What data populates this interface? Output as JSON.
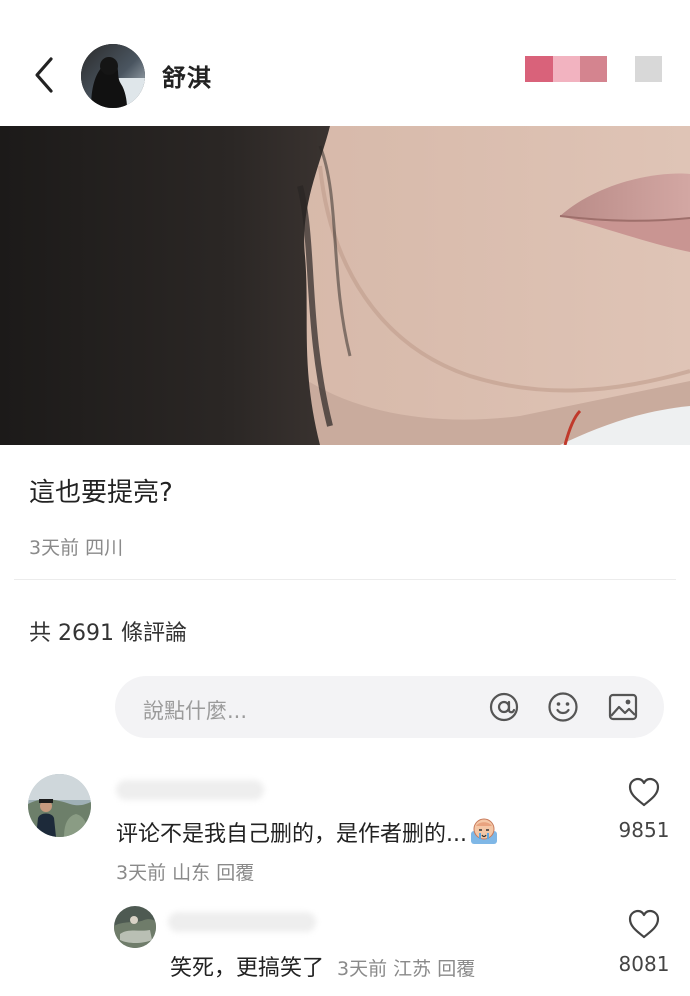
{
  "header": {
    "author_name": "舒淇",
    "blur_colors": [
      "#d9627a",
      "#f2b3c0",
      "#d4848f",
      "#d8d8d8"
    ]
  },
  "post": {
    "title": "這也要提亮?",
    "time": "3天前",
    "location": "四川"
  },
  "comments_section": {
    "count_text": "共 2691 條評論",
    "input_placeholder": "說點什麼...",
    "input_icons": [
      "at-icon",
      "emoji-icon",
      "image-icon"
    ]
  },
  "comments": [
    {
      "text": "评论不是我自己删的，是作者删的...",
      "time": "3天前",
      "location": "山东",
      "reply_label": "回覆",
      "likes": "9851"
    },
    {
      "text": "笑死，更搞笑了",
      "time": "3天前",
      "location": "江苏",
      "reply_label": "回覆",
      "likes": "8081"
    }
  ],
  "colors": {
    "text_primary": "#222222",
    "text_meta": "#8a8a8a",
    "input_bg": "#f3f3f5"
  }
}
